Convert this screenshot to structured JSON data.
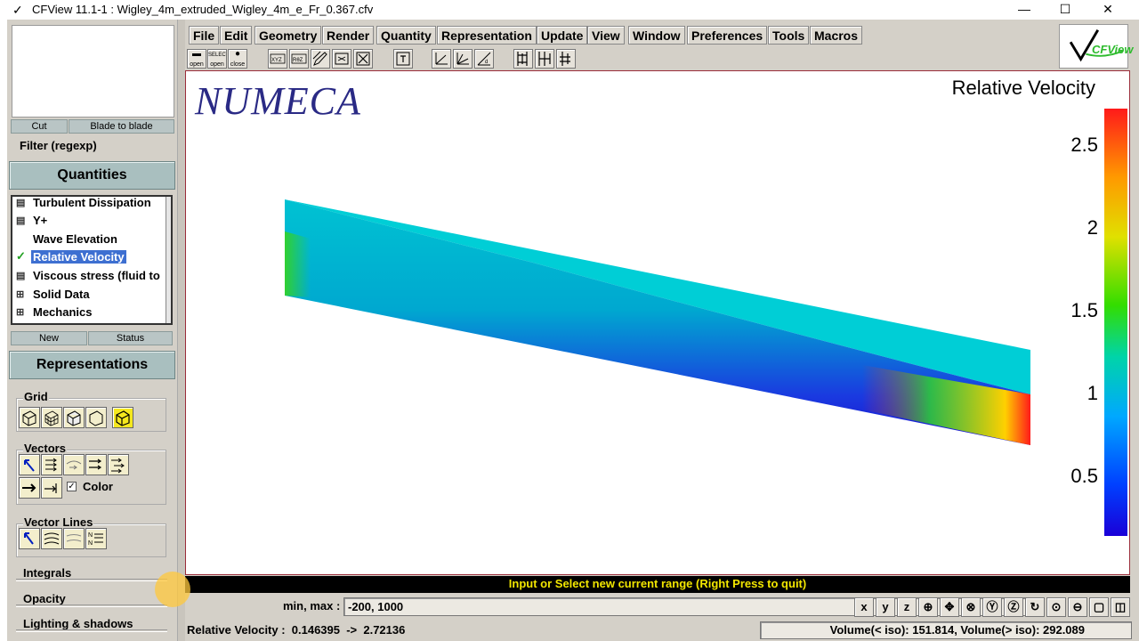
{
  "window": {
    "title": "CFView 11.1-1 : Wigley_4m_extruded_Wigley_4m_e_Fr_0.367.cfv",
    "minimize": "—",
    "maximize": "☐",
    "close": "✕"
  },
  "left": {
    "tabs": [
      "Cut",
      "Blade to blade"
    ],
    "filter_label": "Filter (regexp)",
    "quantities_header": "Quantities",
    "quantities": [
      {
        "label": "Turbulent Dissipation",
        "marker": "📄"
      },
      {
        "label": "Y+",
        "marker": "📄"
      },
      {
        "label": "Wave Elevation",
        "marker": ""
      },
      {
        "label": "Relative Velocity",
        "marker": "✓",
        "selected": true
      },
      {
        "label": "Viscous stress (fluid to",
        "marker": "📄"
      },
      {
        "label": "Solid Data",
        "marker": "⊞"
      },
      {
        "label": "Mechanics",
        "marker": "⊞"
      }
    ],
    "q_buttons": [
      "New",
      "Status"
    ],
    "representations_header": "Representations",
    "grid_label": "Grid",
    "vectors_label": "Vectors",
    "color_label": "Color",
    "color_checked": true,
    "vector_lines_label": "Vector Lines",
    "integrals_label": "Integrals",
    "opacity_label": "Opacity",
    "lighting_label": "Lighting & shadows"
  },
  "menu": [
    "File",
    "Edit",
    "Geometry",
    "Render",
    "Quantity",
    "Representation",
    "Update",
    "View",
    "Window",
    "Preferences",
    "Tools",
    "Macros"
  ],
  "toolbar": {
    "open": "open",
    "select": "SELECT",
    "select_open": "open",
    "close": "close"
  },
  "logo_text": "CFView",
  "viewport": {
    "brand": "NUMECA",
    "title": "Relative Velocity",
    "ticks": [
      "2.5",
      "2",
      "1.5",
      "1",
      "0.5"
    ],
    "colors": {
      "top_face": "#00ced6",
      "side_face": "#00bcd0",
      "low": "#1a00d8",
      "high": "#ff1a1a"
    }
  },
  "status": {
    "prompt": "Input or Select new current range (Right Press to quit)",
    "range_label": "min, max :",
    "range_value": "-200, 1000",
    "view_buttons": [
      "x",
      "y",
      "z"
    ],
    "quantity_readout": "Relative Velocity :  0.146395  ->  2.72136",
    "volume_readout": "Volume(< iso): 151.814, Volume(> iso): 292.089"
  }
}
